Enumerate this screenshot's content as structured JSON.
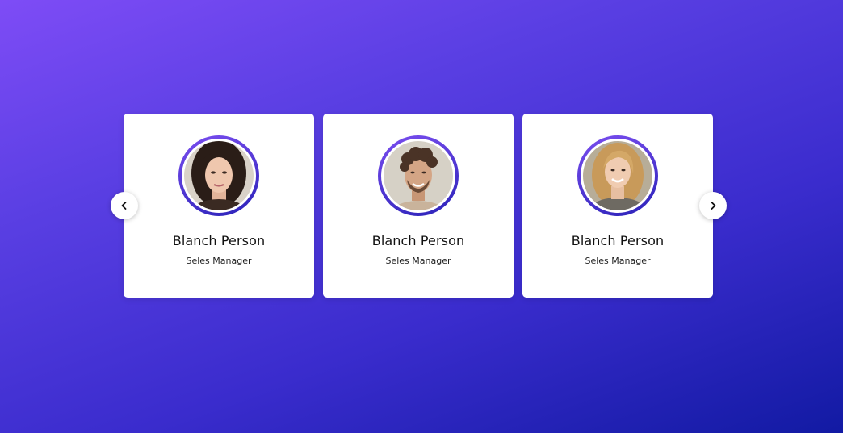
{
  "carousel": {
    "cards": [
      {
        "name": "Blanch Person",
        "role": "Seles Manager",
        "avatar": "woman-dark-hair-photo"
      },
      {
        "name": "Blanch Person",
        "role": "Seles Manager",
        "avatar": "man-curly-hair-photo"
      },
      {
        "name": "Blanch Person",
        "role": "Seles Manager",
        "avatar": "woman-blonde-hair-photo"
      }
    ],
    "prev_icon": "chevron-left-icon",
    "next_icon": "chevron-right-icon"
  },
  "colors": {
    "background_start": "#7e4cf6",
    "background_end": "#121aa3",
    "ring_start": "#7b4ef0",
    "ring_end": "#2a22b8",
    "card": "#ffffff"
  }
}
